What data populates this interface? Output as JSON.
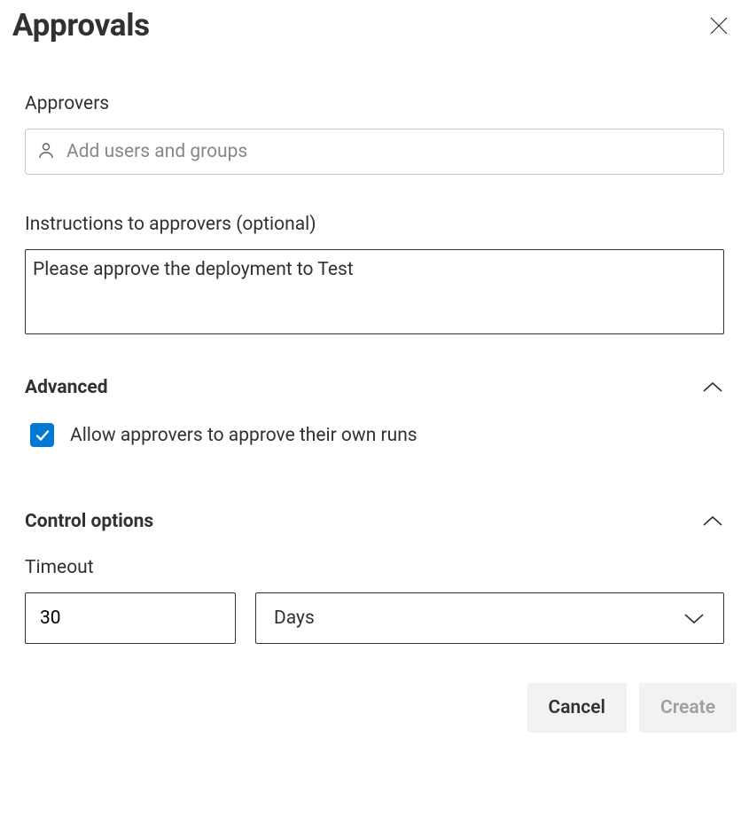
{
  "header": {
    "title": "Approvals"
  },
  "approvers": {
    "label": "Approvers",
    "placeholder": "Add users and groups",
    "value": ""
  },
  "instructions": {
    "label": "Instructions to approvers (optional)",
    "value": "Please approve the deployment to Test"
  },
  "sections": {
    "advanced": {
      "title": "Advanced",
      "allow_own_runs": {
        "checked": true,
        "label": "Allow approvers to approve their own runs"
      }
    },
    "control_options": {
      "title": "Control options",
      "timeout": {
        "label": "Timeout",
        "value": "30",
        "unit": "Days"
      }
    }
  },
  "footer": {
    "cancel": "Cancel",
    "create": "Create"
  }
}
